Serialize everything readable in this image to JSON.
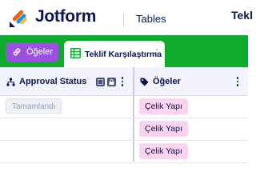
{
  "header": {
    "brand": "Jotform",
    "product": "Tables",
    "title_fragment": "Tekl"
  },
  "tabbar": {
    "items_button_label": "Öğeler",
    "active_tab_label": "Teklif Karşılaştırma"
  },
  "table": {
    "columns": [
      {
        "label": "Approval Status",
        "icon": "sitemap-icon"
      },
      {
        "label": "Öğeler",
        "icon": "tag-icon"
      }
    ],
    "rows": [
      {
        "approval_status": "Tamamlandı",
        "item": "Çelik Yapı"
      },
      {
        "approval_status": "",
        "item": "Çelik Yapı"
      },
      {
        "approval_status": "",
        "item": "Çelik Yapı"
      }
    ]
  },
  "colors": {
    "tabbar_green": "#0fab2f",
    "items_button_purple": "#9b51e0",
    "chip_pink": "#fbd3ee",
    "navy_text": "#0a1551"
  }
}
